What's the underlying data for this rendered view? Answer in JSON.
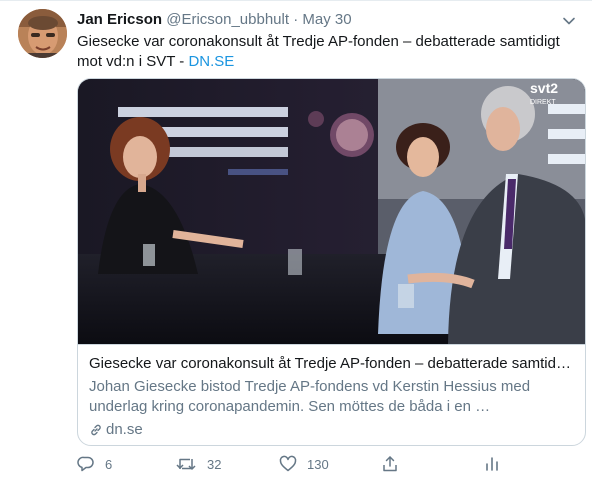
{
  "author": {
    "name": "Jan Ericson",
    "handle": "@Ericson_ubbhult",
    "separator": "·",
    "date": "May 30"
  },
  "tweet": {
    "text": "Giesecke var coronakonsult åt Tredje AP-fonden – debatterade samtidigt mot vd:n i SVT - ",
    "link": "DN.SE"
  },
  "card": {
    "image_badge": "svt2",
    "image_badge_sub": "DIREKT",
    "title": "Giesecke var coronakonsult åt Tredje AP-fonden – debatterade samtidigt mot vd:n i SVT",
    "description": "Johan Giesecke bistod Tredje AP-fondens vd Kerstin Hessius med underlag kring coronapandemin. Sen möttes de båda i en …",
    "domain": "dn.se"
  },
  "actions": {
    "reply_count": "6",
    "retweet_count": "32",
    "like_count": "130"
  },
  "icons": {
    "caret": "chevron-down-icon",
    "reply": "reply-icon",
    "retweet": "retweet-icon",
    "like": "heart-icon",
    "share": "share-icon",
    "analytics": "analytics-icon",
    "link": "link-icon"
  },
  "colors": {
    "link": "#1b95e0",
    "secondary_text": "#657786",
    "border": "#ccd6dd"
  }
}
